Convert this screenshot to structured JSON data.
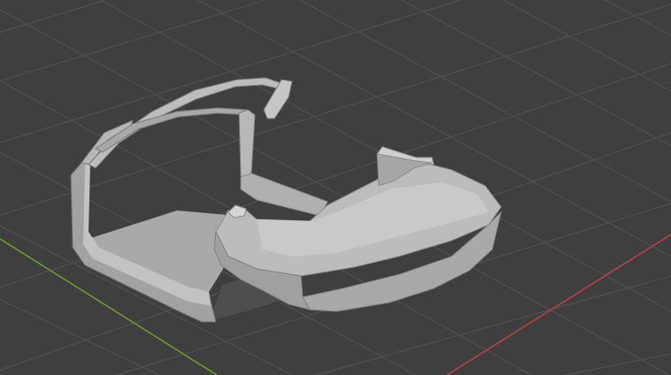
{
  "app": {
    "name": "3D Viewport"
  },
  "viewport": {
    "background_color": "#3f3f3f",
    "grid_color": "#4f4f4f",
    "x_axis_color": "#b8414c",
    "y_axis_color": "#6f9a2c",
    "grid_visible": true
  },
  "scene": {
    "object_type": "car-body-mesh",
    "shading": "solid",
    "body_color": "#b4b4b4",
    "highlight_color": "#cfcfcf",
    "shadow_color": "#8a8a8a",
    "underside_color": "#4e4e4e"
  }
}
